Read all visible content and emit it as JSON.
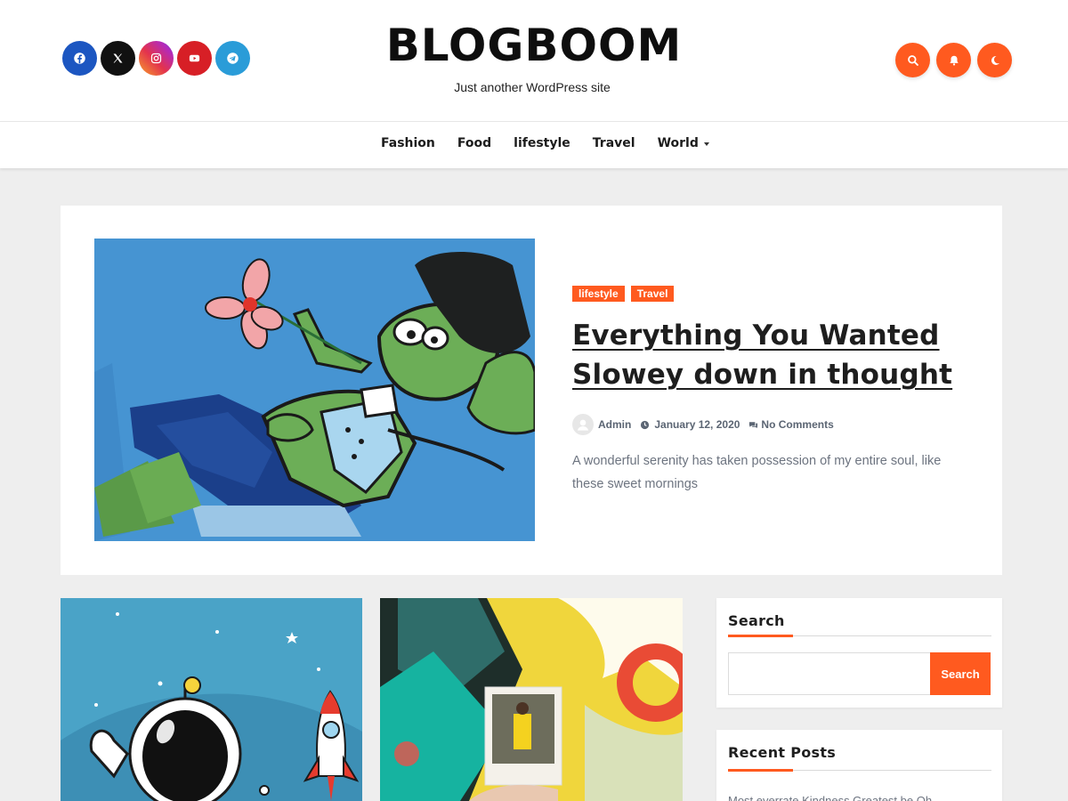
{
  "site": {
    "title": "BLOGBOOM",
    "description": "Just another WordPress site"
  },
  "social": [
    {
      "name": "facebook-icon",
      "color": "#1c56c1"
    },
    {
      "name": "x-twitter-icon",
      "color": "#111111"
    },
    {
      "name": "instagram-icon",
      "color": "#d62d8a"
    },
    {
      "name": "youtube-icon",
      "color": "#d71f26"
    },
    {
      "name": "telegram-icon",
      "color": "#2a9cd8"
    }
  ],
  "header_icons": [
    "search-icon",
    "bell-icon",
    "moon-icon"
  ],
  "accent_color": "#ff5a1f",
  "nav": {
    "items": [
      {
        "label": "Fashion"
      },
      {
        "label": "Food"
      },
      {
        "label": "lifestyle"
      },
      {
        "label": "Travel"
      },
      {
        "label": "World"
      }
    ]
  },
  "featured": {
    "categories": [
      "lifestyle",
      "Travel"
    ],
    "title": "Everything You Wanted Slowey down in thought",
    "author": "Admin",
    "date": "January 12, 2020",
    "comments": "No Comments",
    "excerpt": "A wonderful serenity has taken possession of my entire soul, like these sweet mornings"
  },
  "sidebar": {
    "search": {
      "title": "Search",
      "button_label": "Search",
      "placeholder": ""
    },
    "recent": {
      "title": "Recent Posts",
      "first_item": "Most everrate Kindness Greatest be Oh"
    }
  }
}
